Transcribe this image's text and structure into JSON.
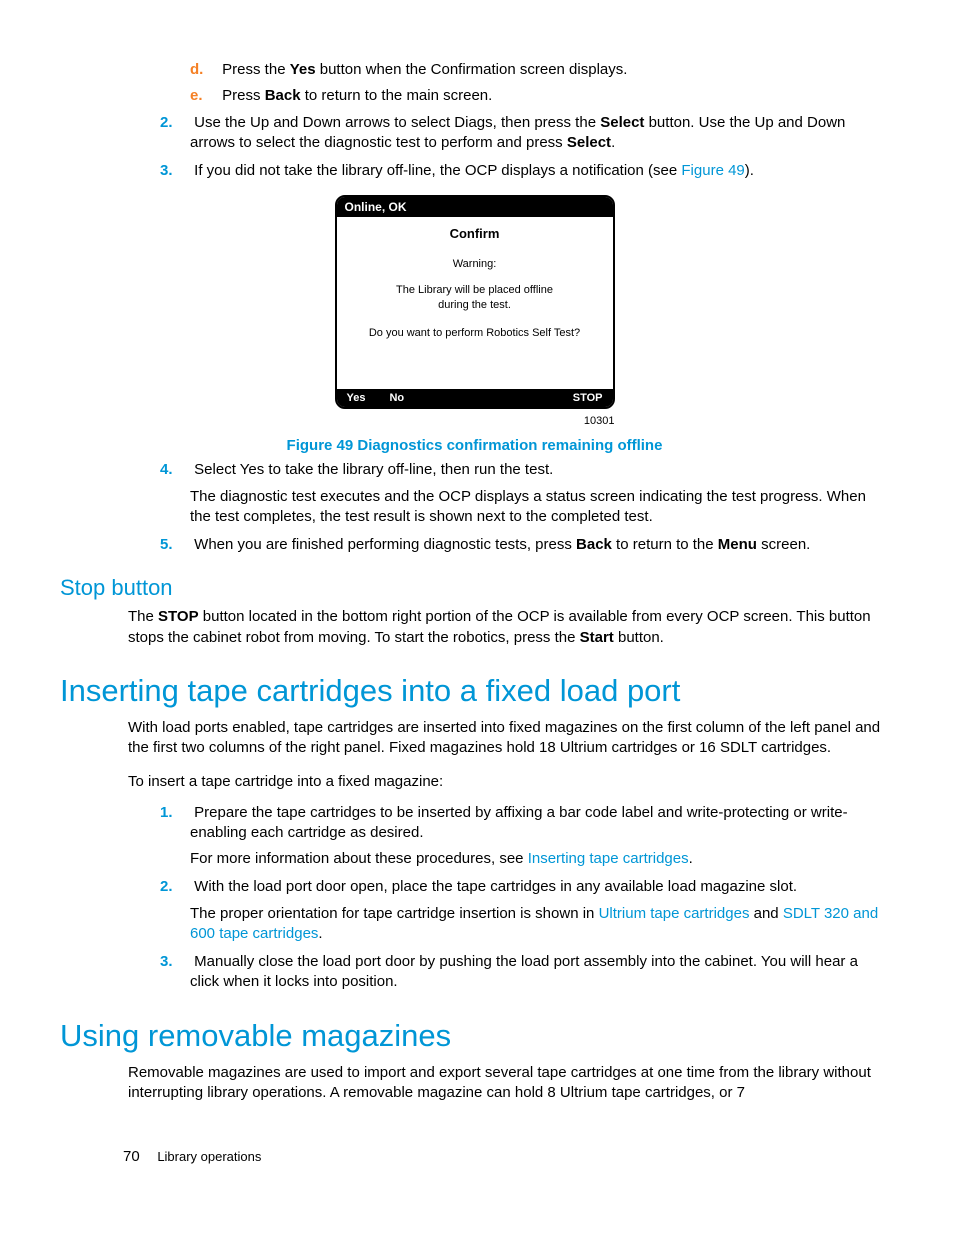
{
  "stepsTop": {
    "sub": [
      {
        "marker": "d.",
        "pre": "Press the ",
        "bold1": "Yes",
        "post1": " button when the Confirmation screen displays."
      },
      {
        "marker": "e.",
        "pre": "Press ",
        "bold1": "Back",
        "post1": " to return to the main screen."
      }
    ],
    "item2": {
      "marker": "2.",
      "pre": "Use the Up and Down arrows to select Diags, then press the ",
      "bold1": "Select",
      "mid": " button. Use the Up and Down arrows to select the diagnostic test to perform and press ",
      "bold2": "Select",
      "post": "."
    },
    "item3": {
      "marker": "3.",
      "pre": "If you did not take the library off-line, the OCP displays a notification (see ",
      "link": "Figure 49",
      "post": ")."
    }
  },
  "ocp": {
    "status": "Online, OK",
    "title": "Confirm",
    "warn": "Warning:",
    "msg1": "The Library will be placed offline",
    "msg2": "during the test.",
    "q": "Do you want to perform Robotics Self Test?",
    "yes": "Yes",
    "no": "No",
    "stop": "STOP",
    "id": "10301"
  },
  "figCaption": "Figure 49 Diagnostics confirmation remaining offline",
  "stepsAfterFig": {
    "item4": {
      "marker": "4.",
      "line1": "Select Yes to take the library off-line, then run the test.",
      "para": "The diagnostic test executes and the OCP displays a status screen indicating the test progress. When the test completes, the test result is shown next to the completed test."
    },
    "item5": {
      "marker": "5.",
      "pre": "When you are finished performing diagnostic tests, press ",
      "bold1": "Back",
      "mid": " to return to the ",
      "bold2": "Menu",
      "post": " screen."
    }
  },
  "stopButton": {
    "heading": "Stop button",
    "p_pre": "The ",
    "p_b1": "STOP",
    "p_mid": " button located in the bottom right portion of the OCP is available from every OCP screen. This button stops the cabinet robot from moving. To start the robotics, press the ",
    "p_b2": "Start",
    "p_post": " button."
  },
  "insert": {
    "heading": "Inserting tape cartridges into a fixed load port",
    "intro": "With load ports enabled, tape cartridges are inserted into fixed magazines on the first column of the left panel and the first two columns of the right panel. Fixed magazines hold 18 Ultrium cartridges or 16 SDLT cartridges.",
    "lead": "To insert a tape cartridge into a fixed magazine:",
    "i1": {
      "marker": "1.",
      "line1": "Prepare the tape cartridges to be inserted by affixing a bar code label and write-protecting or write-enabling each cartridge as desired.",
      "para_pre": "For more information about these procedures, see ",
      "para_link": "Inserting tape cartridges",
      "para_post": "."
    },
    "i2": {
      "marker": "2.",
      "line1": "With the load port door open, place the tape cartridges in any available load magazine slot.",
      "para_pre": "The proper orientation for tape cartridge insertion is shown in ",
      "para_link1": "Ultrium tape cartridges",
      "para_mid": " and ",
      "para_link2": "SDLT 320 and 600 tape cartridges",
      "para_post": "."
    },
    "i3": {
      "marker": "3.",
      "line1": "Manually close the load port door by pushing the load port assembly into the cabinet. You will hear a click when it locks into position."
    }
  },
  "removable": {
    "heading": "Using removable magazines",
    "intro": "Removable magazines are used to import and export several tape cartridges at one time from the library without interrupting library operations. A removable magazine can hold 8 Ultrium tape cartridges, or 7"
  },
  "footer": {
    "page": "70",
    "section": "Library operations"
  }
}
